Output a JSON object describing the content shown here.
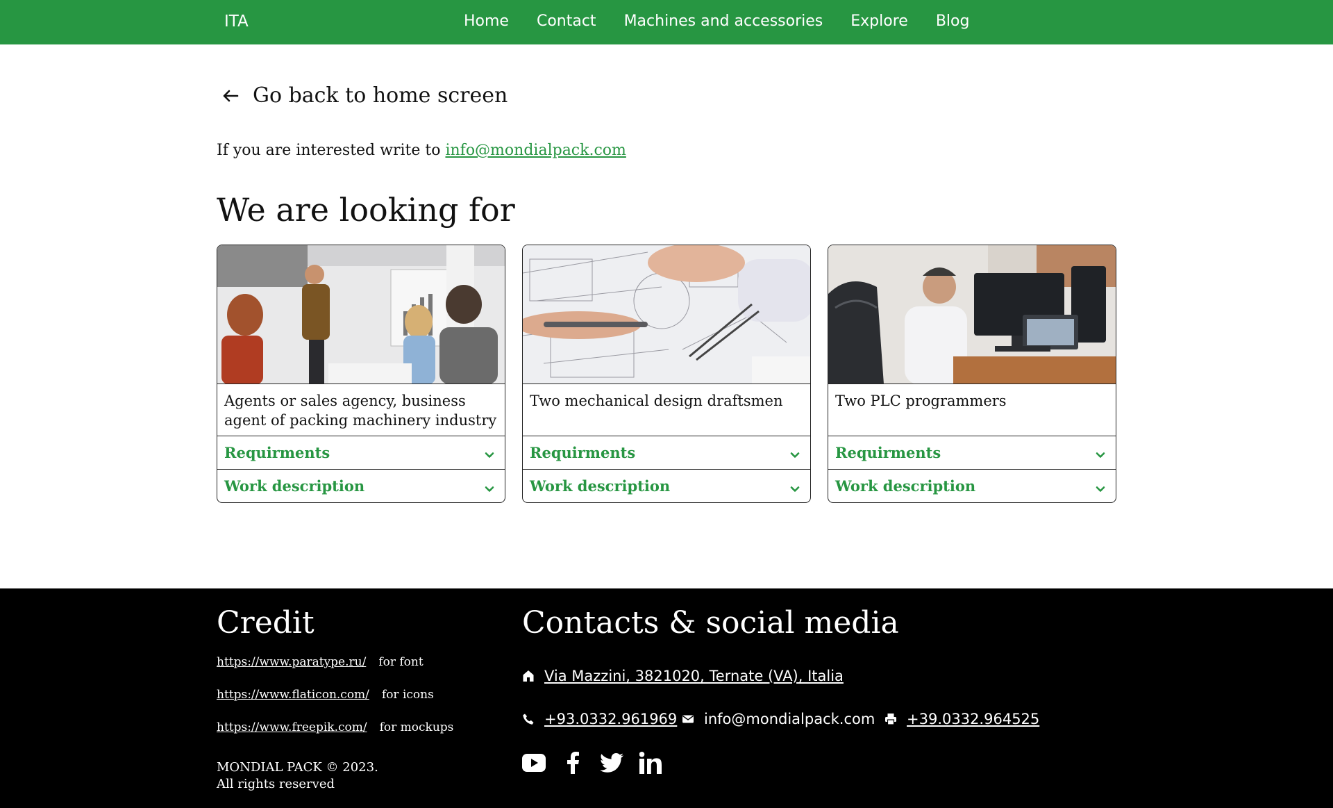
{
  "nav": {
    "brand": "ITA",
    "links": [
      "Home",
      "Contact",
      "Machines and accessories",
      "Explore",
      "Blog"
    ]
  },
  "back": {
    "label": "Go back to home screen"
  },
  "interest": {
    "text": "If you are interested write to",
    "email": "info@mondialpack.com"
  },
  "section_title": "We are looking for",
  "cards": [
    {
      "title": "Agents or sales agency, business agent of packing machinery industry",
      "req": "Requirments",
      "work": "Work description"
    },
    {
      "title": "Two mechanical design draftsmen",
      "req": "Requirments",
      "work": "Work description"
    },
    {
      "title": "Two PLC programmers",
      "req": "Requirments",
      "work": "Work description"
    }
  ],
  "footer": {
    "credit_title": "Credit",
    "credits": [
      {
        "url": "https://www.paratype.ru/",
        "for": "for font"
      },
      {
        "url": "https://www.flaticon.com/",
        "for": "for icons"
      },
      {
        "url": "https://www.freepik.com/",
        "for": "for mockups"
      }
    ],
    "copyright_line1": "MONDIAL PACK © 2023.",
    "copyright_line2": "All rights reserved",
    "contact_title": "Contacts & social media",
    "address": "Via Mazzini, 3821020, Ternate (VA), Italia",
    "phone": "+93.0332.961969",
    "email": "info@mondialpack.com",
    "fax": "+39.0332.964525"
  },
  "colors": {
    "brand_green": "#279642",
    "footer_bg": "#000000"
  },
  "icons": [
    "arrow-left-icon",
    "chevron-down-icon",
    "home-icon",
    "phone-icon",
    "mail-icon",
    "printer-icon",
    "youtube-icon",
    "facebook-icon",
    "twitter-icon",
    "linkedin-icon"
  ]
}
